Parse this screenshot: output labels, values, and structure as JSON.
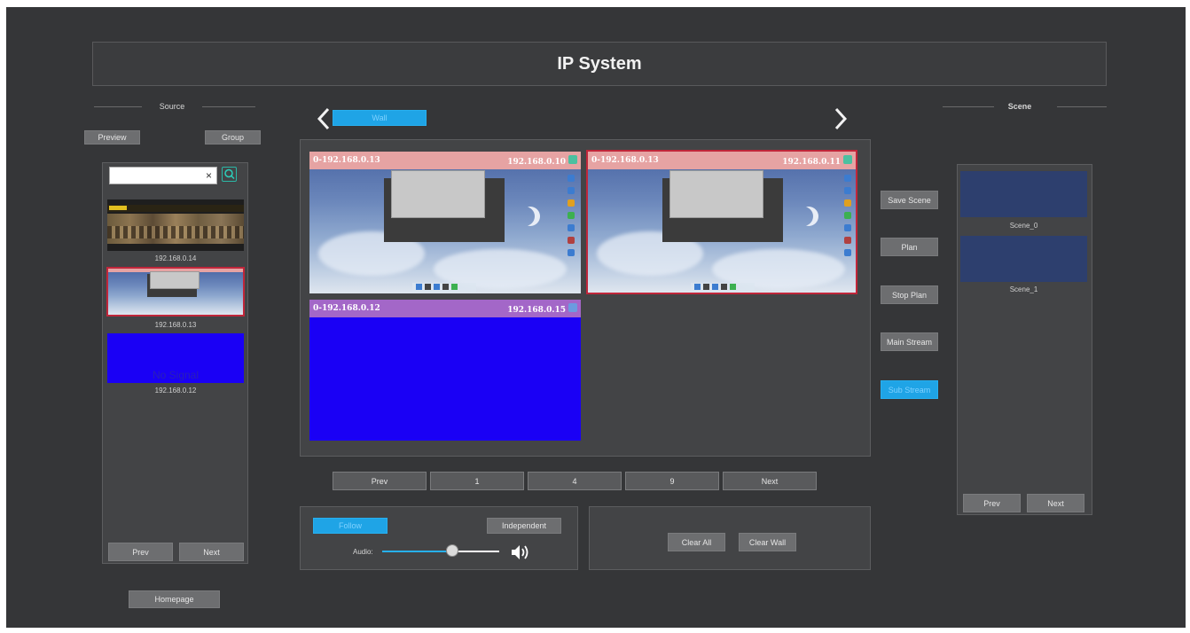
{
  "app": {
    "title": "IP System"
  },
  "source": {
    "header": "Source",
    "preview_label": "Preview",
    "group_label": "Group",
    "search": {
      "value": "",
      "clear_glyph": "×"
    },
    "items": [
      {
        "label": "192.168.0.14"
      },
      {
        "label": "192.168.0.13"
      },
      {
        "label": "192.168.0.12",
        "overlay": "No Signal"
      }
    ],
    "prev_label": "Prev",
    "next_label": "Next",
    "homepage_label": "Homepage"
  },
  "wall": {
    "tab_label": "Wall",
    "windows": [
      {
        "left": "0-192.168.0.13",
        "right": "192.168.0.10"
      },
      {
        "left": "0-192.168.0.13",
        "right": "192.168.0.11"
      },
      {
        "left": "0-192.168.0.12",
        "right": "192.168.0.15"
      }
    ],
    "pager": {
      "prev": "Prev",
      "p1": "1",
      "p4": "4",
      "p9": "9",
      "next": "Next"
    }
  },
  "controls": {
    "save_scene": "Save Scene",
    "plan": "Plan",
    "stop_plan": "Stop Plan",
    "main_stream": "Main Stream",
    "sub_stream": "Sub Stream"
  },
  "audio": {
    "follow_label": "Follow",
    "independent_label": "Independent",
    "audio_label": "Audio:",
    "volume": 0.6
  },
  "wall_actions": {
    "clear_all": "Clear All",
    "clear_wall": "Clear Wall"
  },
  "scene": {
    "header": "Scene",
    "items": [
      {
        "label": "Scene_0"
      },
      {
        "label": "Scene_1"
      }
    ],
    "prev_label": "Prev",
    "next_label": "Next"
  },
  "colors": {
    "accent": "#1fa4e6",
    "selected_border": "#c0263a",
    "no_signal_blue": "#1a00f5",
    "header_pink": "#e6a3a3",
    "header_purple": "#a367c8"
  }
}
